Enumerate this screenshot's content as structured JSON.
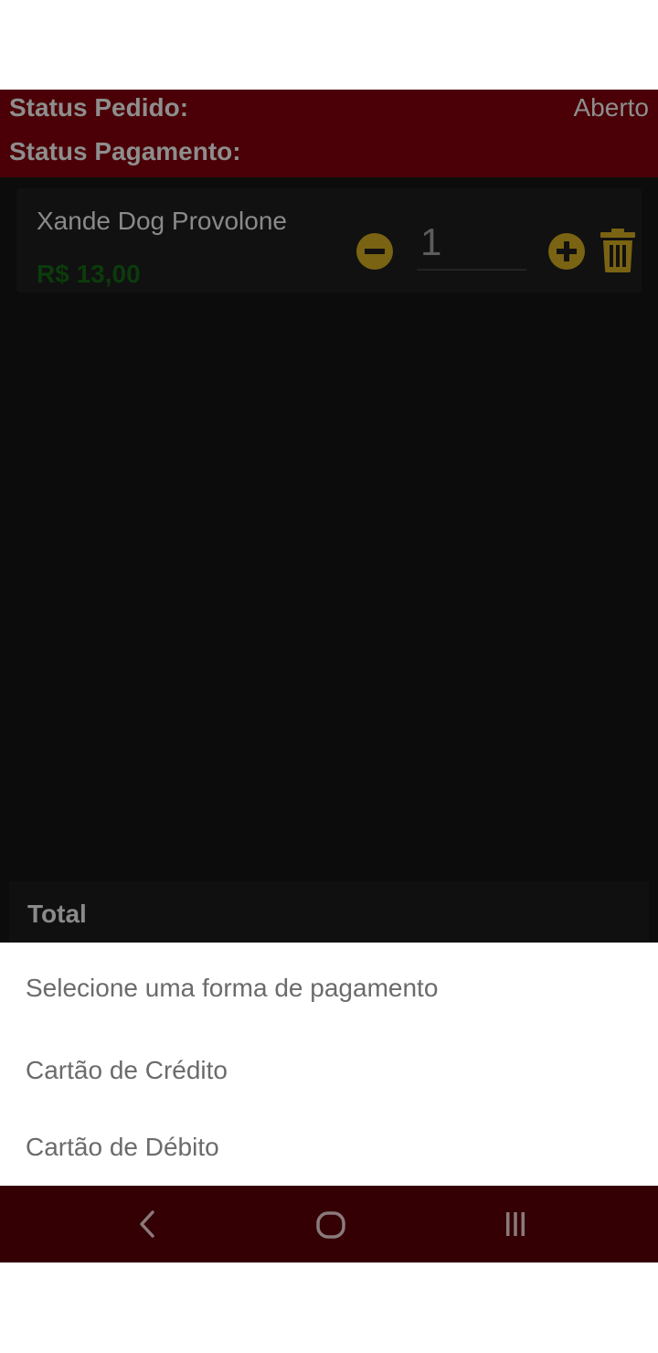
{
  "status": {
    "pedido_label": "Status Pedido:",
    "pedido_value": "Aberto",
    "pagamento_label": "Status Pagamento:"
  },
  "cart": {
    "items": [
      {
        "name": "Xande Dog Provolone",
        "price": "R$ 13,00",
        "quantity": "1"
      }
    ],
    "total_label": "Total"
  },
  "payment_sheet": {
    "title": "Selecione uma forma de pagamento",
    "options": [
      "Cartão de Crédito",
      "Cartão de Débito"
    ]
  },
  "icons": {
    "minus": "minus-circle-icon",
    "plus": "plus-circle-icon",
    "trash": "trash-icon",
    "back": "back-icon",
    "home": "home-icon",
    "recent": "recent-apps-icon"
  },
  "colors": {
    "header_bg": "#4a0006",
    "accent_gold": "#7a6312",
    "price_green": "#0c3b0c",
    "nav_bg": "#340004"
  }
}
